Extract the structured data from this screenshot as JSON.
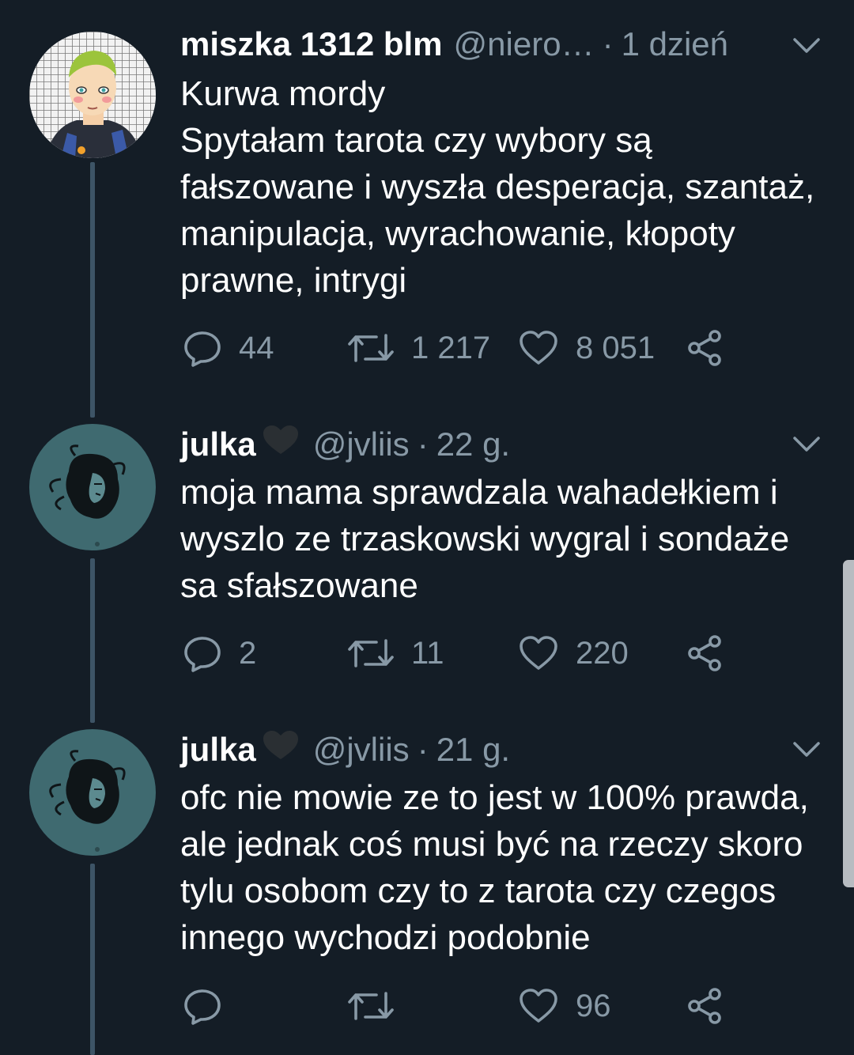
{
  "tweets": [
    {
      "name": "miszka 1312 blm",
      "handle": "@niero…",
      "time": "1 dzień",
      "text": "Kurwa mordy\nSpytałam tarota czy wybory są fałszowane i wyszła desperacja, szantaż, manipulacja, wyrachowanie, kłopoty prawne, intrygi",
      "replies": "44",
      "retweets": "1 217",
      "likes": "8 051",
      "avatar_icon": "cartoon-avatar-icon"
    },
    {
      "name": "julka",
      "handle": "@jvliis",
      "time": "22 g.",
      "text": "moja mama sprawdzala wahadełkiem i wyszlo ze trzaskowski wygral i sondaże sa sfałszowane",
      "replies": "2",
      "retweets": "11",
      "likes": "220",
      "avatar_icon": "sketch-portrait-avatar-icon"
    },
    {
      "name": "julka",
      "handle": "@jvliis",
      "time": "21 g.",
      "text": "ofc nie mowie ze to jest w 100% prawda, ale jednak coś musi być na rzeczy skoro tylu osobom czy to z tarota czy czegos innego wychodzi podobnie",
      "replies": "",
      "retweets": "",
      "likes": "96",
      "avatar_icon": "sketch-portrait-avatar-icon"
    }
  ],
  "icons": {
    "reply": "reply-icon",
    "retweet": "retweet-icon",
    "like": "heart-icon",
    "share": "share-icon",
    "menu": "chevron-down-icon",
    "badge": "black-heart-icon"
  },
  "colors": {
    "background": "#141d26",
    "secondary_text": "#8899a6",
    "thread_line": "#3d5466",
    "julka_avatar_bg": "#3f6a70"
  }
}
